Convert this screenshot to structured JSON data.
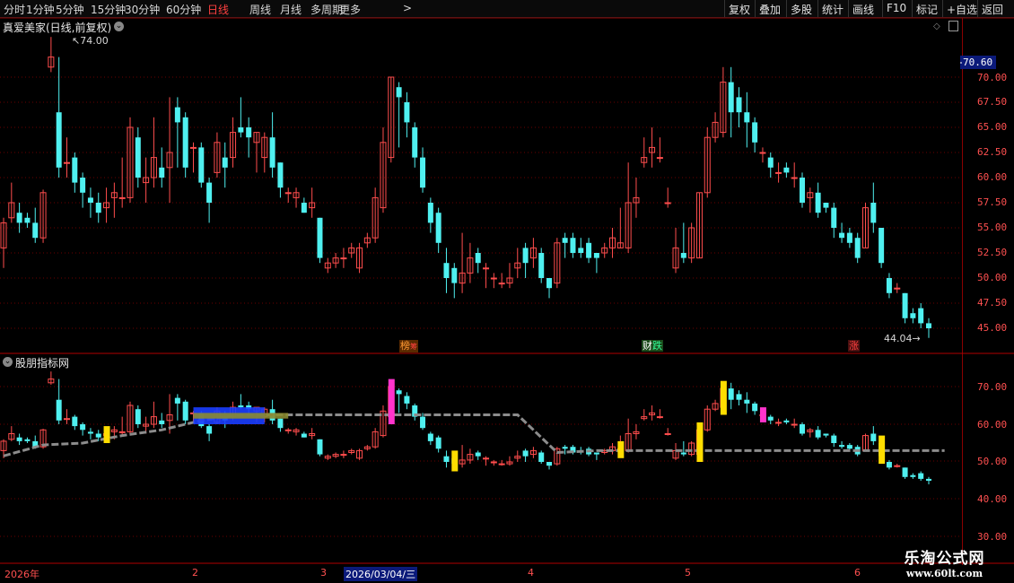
{
  "toolbar": {
    "periods": [
      "分时",
      "1分钟",
      "5分钟",
      "15分钟",
      "30分钟",
      "60分钟",
      "日线",
      "周线",
      "月线",
      "多周期",
      "更多"
    ],
    "active": "日线",
    "more_arrow": ">",
    "right_buttons": [
      "复权",
      "叠加",
      "多股",
      "统计",
      "画线",
      "F10",
      "标记",
      "+自选",
      "返回"
    ]
  },
  "main_chart": {
    "stock_title": "真爱美家(日线,前复权)",
    "high_marker": "74.00",
    "low_marker": "44.04",
    "current_price_label": "70.60",
    "y_ticks": [
      "70.00",
      "67.50",
      "65.00",
      "62.50",
      "60.00",
      "57.50",
      "55.00",
      "52.50",
      "50.00",
      "47.50",
      "45.00"
    ],
    "annotations": [
      {
        "text": "榜",
        "color": "#ff9933"
      },
      {
        "text": "筹",
        "color": "#ff4040"
      },
      {
        "text": "财",
        "color": "#ffffff"
      },
      {
        "text": "跌",
        "color": "#33ff99"
      },
      {
        "text": "涨",
        "color": "#ff4040"
      }
    ]
  },
  "indicator_chart": {
    "title": "股朋指标网",
    "y_ticks": [
      "70.00",
      "60.00",
      "50.00",
      "40.00",
      "30.00"
    ]
  },
  "x_axis": {
    "labels": [
      "2026年",
      "2",
      "3",
      "2026/03/04/三",
      "4",
      "5",
      "6"
    ]
  },
  "watermark": {
    "name": "乐淘公式网",
    "url": "www.60lt.com"
  },
  "colors": {
    "up": "#ff4d4d",
    "down": "#4ff0f0",
    "axis": "#ff5050",
    "grid": "#6a0000",
    "yellow_bar": "#ffdd00",
    "magenta_bar": "#ff33cc",
    "gray_line": "#8c8c8c",
    "blue_band": "#1a3dff",
    "olive_band": "#8a8a30"
  },
  "chart_data": {
    "type": "candlestick",
    "price_axis_main": [
      44.04,
      74.0
    ],
    "price_axis_indicator": [
      30,
      75
    ],
    "candles": [
      [
        53.0,
        55.5,
        51.0,
        56.0
      ],
      [
        56.0,
        57.5,
        55.5,
        59.5
      ],
      [
        56.5,
        55.5,
        54.5,
        57.5
      ],
      [
        56.0,
        55.5,
        55.0,
        56.5
      ],
      [
        55.5,
        54.0,
        53.5,
        57.0
      ],
      [
        54.0,
        58.5,
        53.5,
        58.8
      ],
      [
        71.0,
        72.0,
        70.5,
        74.0
      ],
      [
        66.5,
        61.0,
        60.0,
        72.0
      ],
      [
        61.5,
        61.5,
        60.0,
        64.0
      ],
      [
        62.0,
        59.5,
        58.5,
        62.5
      ],
      [
        60.0,
        58.5,
        57.0,
        60.5
      ],
      [
        58.0,
        57.5,
        56.0,
        59.0
      ],
      [
        57.5,
        56.5,
        55.5,
        58.5
      ],
      [
        57.0,
        57.5,
        55.5,
        59.0
      ],
      [
        58.0,
        58.5,
        56.0,
        59.5
      ],
      [
        58.0,
        58.0,
        57.0,
        62.0
      ],
      [
        58.0,
        65.0,
        57.5,
        66.0
      ],
      [
        64.0,
        60.0,
        59.0,
        65.0
      ],
      [
        59.5,
        60.0,
        57.5,
        62.0
      ],
      [
        60.0,
        62.0,
        59.0,
        66.0
      ],
      [
        61.0,
        60.0,
        59.0,
        63.0
      ],
      [
        61.0,
        62.5,
        57.5,
        68.0
      ],
      [
        67.0,
        65.5,
        61.0,
        68.0
      ],
      [
        66.0,
        61.0,
        60.0,
        66.5
      ],
      [
        63.0,
        63.0,
        60.5,
        63.5
      ],
      [
        63.0,
        59.5,
        59.0,
        63.5
      ],
      [
        59.5,
        57.5,
        55.5,
        60.0
      ],
      [
        60.5,
        63.5,
        60.0,
        64.5
      ],
      [
        62.0,
        61.0,
        59.0,
        63.5
      ],
      [
        62.0,
        64.5,
        61.0,
        66.0
      ],
      [
        65.0,
        64.5,
        64.0,
        68.0
      ],
      [
        65.0,
        64.0,
        62.0,
        66.0
      ],
      [
        63.5,
        64.5,
        60.5,
        64.5
      ],
      [
        62.0,
        64.0,
        60.5,
        64.5
      ],
      [
        64.0,
        61.0,
        60.0,
        66.5
      ],
      [
        61.5,
        59.0,
        58.0,
        61.5
      ],
      [
        58.5,
        58.5,
        57.5,
        59.0
      ],
      [
        58.0,
        58.5,
        57.0,
        59.0
      ],
      [
        57.5,
        56.5,
        56.5,
        58.0
      ],
      [
        57.0,
        57.5,
        56.0,
        59.0
      ],
      [
        56.0,
        52.0,
        51.5,
        56.0
      ],
      [
        51.0,
        51.5,
        50.5,
        52.0
      ],
      [
        51.5,
        52.0,
        51.0,
        52.5
      ],
      [
        52.0,
        52.0,
        51.0,
        53.0
      ],
      [
        52.5,
        53.0,
        52.0,
        53.5
      ],
      [
        51.0,
        53.0,
        50.5,
        53.5
      ],
      [
        53.5,
        54.0,
        53.0,
        54.5
      ],
      [
        54.0,
        58.0,
        53.5,
        59.0
      ],
      [
        57.0,
        63.5,
        56.5,
        65.0
      ],
      [
        62.0,
        70.0,
        61.5,
        70.0
      ],
      [
        69.0,
        68.0,
        63.0,
        69.5
      ],
      [
        67.5,
        65.5,
        64.0,
        68.5
      ],
      [
        65.0,
        62.0,
        61.0,
        65.5
      ],
      [
        62.0,
        59.0,
        58.5,
        63.0
      ],
      [
        57.5,
        55.5,
        54.5,
        58.0
      ],
      [
        56.5,
        53.5,
        52.5,
        57.0
      ],
      [
        51.5,
        50.0,
        48.5,
        53.0
      ],
      [
        51.0,
        49.5,
        48.0,
        51.5
      ],
      [
        49.5,
        50.5,
        48.5,
        54.5
      ],
      [
        50.5,
        52.0,
        49.5,
        53.5
      ],
      [
        52.5,
        51.5,
        50.5,
        53.0
      ],
      [
        51.0,
        51.0,
        49.0,
        51.5
      ],
      [
        50.0,
        50.0,
        49.0,
        50.5
      ],
      [
        49.5,
        49.5,
        49.0,
        50.5
      ],
      [
        49.5,
        50.0,
        49.0,
        51.5
      ],
      [
        51.0,
        51.5,
        50.0,
        53.0
      ],
      [
        53.0,
        51.5,
        50.0,
        53.5
      ],
      [
        52.0,
        53.0,
        51.0,
        54.0
      ],
      [
        52.5,
        50.0,
        49.5,
        53.0
      ],
      [
        50.0,
        49.0,
        48.0,
        50.0
      ],
      [
        49.5,
        53.5,
        49.0,
        54.0
      ],
      [
        54.0,
        53.5,
        52.0,
        54.5
      ],
      [
        54.0,
        52.5,
        52.0,
        54.5
      ],
      [
        53.0,
        52.5,
        52.0,
        54.0
      ],
      [
        53.5,
        52.0,
        51.5,
        54.0
      ],
      [
        52.5,
        52.0,
        50.5,
        52.5
      ],
      [
        52.5,
        53.0,
        52.0,
        53.5
      ],
      [
        53.0,
        54.0,
        52.0,
        55.0
      ],
      [
        53.0,
        53.5,
        53.0,
        57.0
      ],
      [
        53.0,
        57.5,
        52.5,
        61.5
      ],
      [
        57.5,
        58.0,
        56.0,
        60.0
      ],
      [
        61.5,
        62.0,
        61.0,
        64.0
      ],
      [
        62.5,
        63.0,
        61.0,
        65.0
      ],
      [
        62.0,
        62.0,
        61.5,
        64.0
      ],
      [
        57.5,
        57.5,
        57.0,
        59.0
      ],
      [
        51.0,
        53.0,
        50.5,
        55.0
      ],
      [
        52.5,
        52.0,
        51.5,
        55.5
      ],
      [
        52.0,
        55.0,
        51.5,
        55.5
      ],
      [
        52.0,
        58.5,
        52.0,
        58.5
      ],
      [
        58.5,
        64.0,
        58.0,
        65.0
      ],
      [
        64.0,
        65.5,
        63.5,
        66.5
      ],
      [
        64.5,
        69.5,
        64.0,
        71.0
      ],
      [
        69.5,
        66.5,
        64.0,
        71.0
      ],
      [
        68.0,
        66.5,
        65.0,
        69.0
      ],
      [
        66.5,
        65.5,
        63.0,
        68.5
      ],
      [
        65.5,
        63.5,
        62.5,
        66.0
      ],
      [
        62.5,
        62.5,
        61.5,
        63.0
      ],
      [
        62.0,
        61.0,
        60.0,
        62.5
      ],
      [
        60.5,
        60.5,
        59.5,
        61.5
      ],
      [
        61.0,
        60.5,
        60.0,
        61.5
      ],
      [
        60.0,
        60.0,
        59.0,
        61.5
      ],
      [
        60.0,
        57.5,
        57.0,
        60.5
      ],
      [
        58.0,
        58.5,
        56.5,
        59.0
      ],
      [
        58.5,
        56.5,
        56.0,
        59.5
      ],
      [
        57.5,
        57.0,
        56.5,
        57.5
      ],
      [
        57.0,
        55.0,
        54.0,
        57.5
      ],
      [
        54.5,
        54.0,
        53.5,
        55.5
      ],
      [
        54.5,
        53.5,
        53.0,
        55.0
      ],
      [
        54.0,
        52.0,
        51.5,
        54.5
      ],
      [
        53.0,
        57.0,
        53.0,
        57.5
      ],
      [
        57.5,
        55.5,
        54.5,
        59.5
      ],
      [
        55.0,
        51.5,
        51.0,
        55.0
      ],
      [
        50.0,
        48.5,
        48.0,
        50.5
      ],
      [
        49.0,
        49.0,
        48.5,
        49.5
      ],
      [
        48.5,
        46.0,
        45.5,
        48.5
      ],
      [
        46.5,
        46.0,
        45.5,
        47.0
      ],
      [
        47.0,
        45.5,
        45.0,
        47.5
      ],
      [
        45.5,
        45.0,
        44.04,
        46.0
      ]
    ],
    "signal_bars": [
      {
        "index": 13,
        "color": "yellow"
      },
      {
        "index": 49,
        "color": "magenta"
      },
      {
        "index": 57,
        "color": "yellow"
      },
      {
        "index": 78,
        "color": "yellow"
      },
      {
        "index": 88,
        "color": "yellow"
      },
      {
        "index": 91,
        "color": "yellow"
      },
      {
        "index": 96,
        "color": "magenta"
      },
      {
        "index": 111,
        "color": "yellow"
      }
    ],
    "ma_line": [
      [
        0,
        51.6
      ],
      [
        5,
        54.5
      ],
      [
        10,
        55.0
      ],
      [
        15,
        57.0
      ],
      [
        20,
        58.5
      ],
      [
        25,
        61.0
      ],
      [
        30,
        62.5
      ],
      [
        35,
        62.5
      ],
      [
        40,
        62.5
      ],
      [
        45,
        62.5
      ],
      [
        50,
        62.5
      ],
      [
        55,
        62.5
      ],
      [
        60,
        62.5
      ],
      [
        65,
        62.5
      ],
      [
        70,
        52.5
      ],
      [
        75,
        53.0
      ],
      [
        80,
        53.0
      ],
      [
        85,
        53.0
      ],
      [
        90,
        53.0
      ],
      [
        95,
        53.0
      ],
      [
        100,
        53.0
      ],
      [
        105,
        53.0
      ],
      [
        110,
        53.0
      ],
      [
        115,
        53.0
      ],
      [
        119,
        53.0
      ]
    ],
    "bands": [
      {
        "from": 24,
        "to": 33,
        "low": 60.0,
        "high": 64.5,
        "color": "blue"
      },
      {
        "from": 24,
        "to": 36,
        "low": 61.5,
        "high": 63.0,
        "color": "olive"
      }
    ]
  }
}
